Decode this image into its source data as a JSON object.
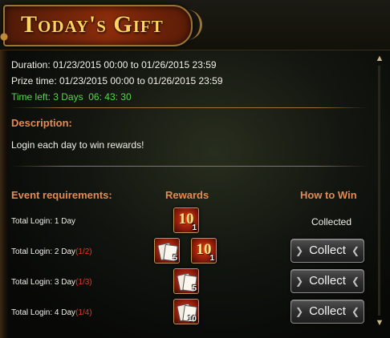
{
  "header": {
    "title": "Today's Gift"
  },
  "event": {
    "duration": "Duration: 01/23/2015 00:00 to 01/26/2015 23:59",
    "prize_time": "Prize time: 01/23/2015 00:00 to 01/26/2015 23:59",
    "time_left_label": "Time left: 3 Days",
    "time_left_clock": "06: 43: 30"
  },
  "description": {
    "heading": "Description:",
    "text": "Login each day to win rewards!"
  },
  "table": {
    "col_requirements": "Event requirements:",
    "col_rewards": "Rewards",
    "col_how_to_win": "How to Win"
  },
  "rows": [
    {
      "label": "Total Login: 1 Day",
      "progress": "",
      "status": "Collected",
      "rewards": [
        {
          "icon": "fire-10-token-icon",
          "qty": "1"
        }
      ]
    },
    {
      "label": "Total Login: 2 Day",
      "progress": "(1/2)",
      "button": "Collect",
      "rewards": [
        {
          "icon": "card-pack-icon",
          "qty": "5"
        },
        {
          "icon": "fire-10-token-icon",
          "qty": "1"
        }
      ]
    },
    {
      "label": "Total Login: 3 Day",
      "progress": "(1/3)",
      "button": "Collect",
      "rewards": [
        {
          "icon": "card-pack-icon",
          "qty": "5"
        }
      ]
    },
    {
      "label": "Total Login: 4 Day",
      "progress": "(1/4)",
      "button": "Collect",
      "rewards": [
        {
          "icon": "card-pack-icon",
          "qty": "10"
        }
      ]
    }
  ],
  "icons": {
    "token_glyph": "10"
  },
  "colors": {
    "title_gold": "#ffd35e",
    "green_timer": "#56d64a",
    "orange_heading": "#e58a52",
    "red_progress": "#e23a2a"
  }
}
